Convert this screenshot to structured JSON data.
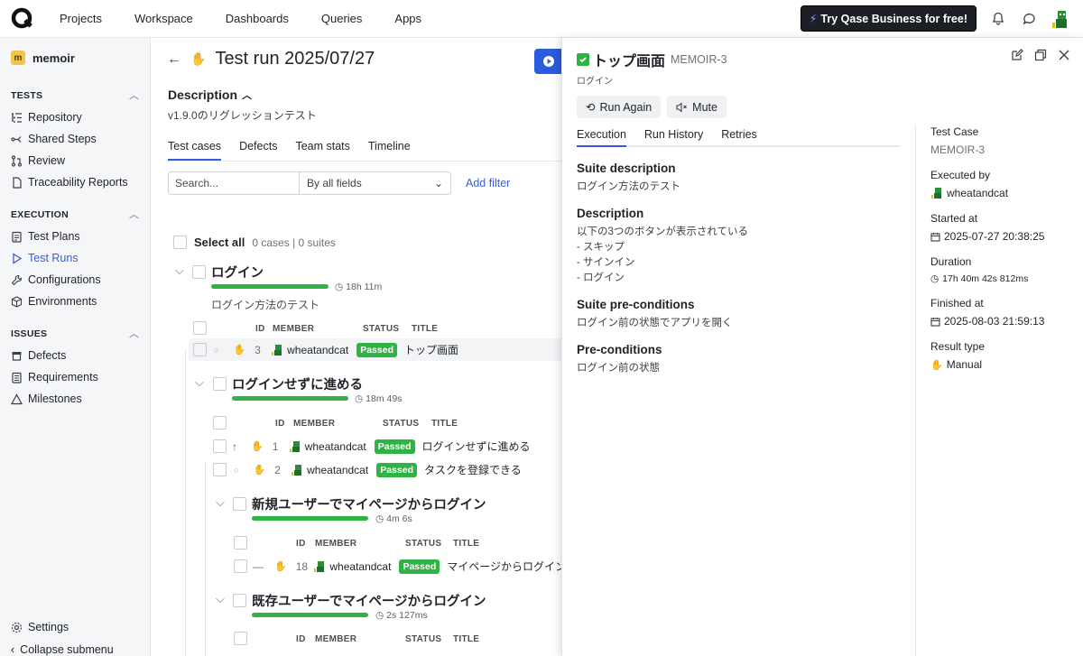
{
  "nav": {
    "items": [
      "Projects",
      "Workspace",
      "Dashboards",
      "Queries",
      "Apps"
    ],
    "promo": "Try Qase Business for free!"
  },
  "sidebar": {
    "project": {
      "badge": "m",
      "name": "memoir"
    },
    "tests_header": "TESTS",
    "tests": [
      "Repository",
      "Shared Steps",
      "Review",
      "Traceability Reports"
    ],
    "execution_header": "EXECUTION",
    "execution": [
      "Test Plans",
      "Test Runs",
      "Configurations",
      "Environments"
    ],
    "issues_header": "ISSUES",
    "issues": [
      "Defects",
      "Requirements",
      "Milestones"
    ],
    "settings": "Settings",
    "collapse": "Collapse submenu"
  },
  "main": {
    "title": "Test run 2025/07/27",
    "desc_title": "Description",
    "desc_text": "v1.9.0のリグレッションテスト",
    "tabs": [
      "Test cases",
      "Defects",
      "Team stats",
      "Timeline"
    ],
    "search_placeholder": "Search...",
    "filter_select": "By all fields",
    "add_filter": "Add filter",
    "select_all": "Select all",
    "counts": "0 cases | 0 suites",
    "columns": {
      "id": "ID",
      "member": "MEMBER",
      "status": "STATUS",
      "title": "TITLE"
    },
    "suites": [
      {
        "title": "ログイン",
        "duration": "18h 11m",
        "desc": "ログイン方法のテスト",
        "rows": [
          {
            "id": "3",
            "member": "wheatandcat",
            "status": "Passed",
            "title": "トップ画面"
          }
        ]
      },
      {
        "title": "ログインせずに進める",
        "duration": "18m 49s",
        "rows": [
          {
            "id": "1",
            "member": "wheatandcat",
            "status": "Passed",
            "title": "ログインせずに進める"
          },
          {
            "id": "2",
            "member": "wheatandcat",
            "status": "Passed",
            "title": "タスクを登録できる"
          }
        ]
      },
      {
        "title": "新規ユーザーでマイページからログイン",
        "duration": "4m 6s",
        "rows": [
          {
            "id": "18",
            "member": "wheatandcat",
            "status": "Passed",
            "title": "マイページからログイン"
          }
        ]
      },
      {
        "title": "既存ユーザーでマイページからログイン",
        "duration": "2s 127ms",
        "rows": []
      }
    ]
  },
  "panel": {
    "title": "トップ画面",
    "code": "MEMOIR-3",
    "crumb": "ログイン",
    "run_again": "Run Again",
    "mute": "Mute",
    "tabs": [
      "Execution",
      "Run History",
      "Retries"
    ],
    "sections": [
      {
        "h": "Suite description",
        "lines": [
          "ログイン方法のテスト"
        ]
      },
      {
        "h": "Description",
        "lines": [
          "以下の3つのボタンが表示されている",
          "- スキップ",
          "- サインイン",
          "- ログイン"
        ]
      },
      {
        "h": "Suite pre-conditions",
        "lines": [
          "ログイン前の状態でアプリを開く"
        ]
      },
      {
        "h": "Pre-conditions",
        "lines": [
          "ログイン前の状態"
        ]
      }
    ],
    "meta": {
      "test_case_k": "Test Case",
      "test_case_v": "MEMOIR-3",
      "executed_by_k": "Executed by",
      "executed_by_v": "wheatandcat",
      "started_k": "Started at",
      "started_v": "2025-07-27 20:38:25",
      "duration_k": "Duration",
      "duration_v": "17h 40m 42s 812ms",
      "finished_k": "Finished at",
      "finished_v": "2025-08-03 21:59:13",
      "result_k": "Result type",
      "result_v": "Manual"
    }
  },
  "colors": {
    "accent": "#3b5bdb",
    "passed": "#2fb344",
    "promo_bg": "#1c1f26"
  }
}
